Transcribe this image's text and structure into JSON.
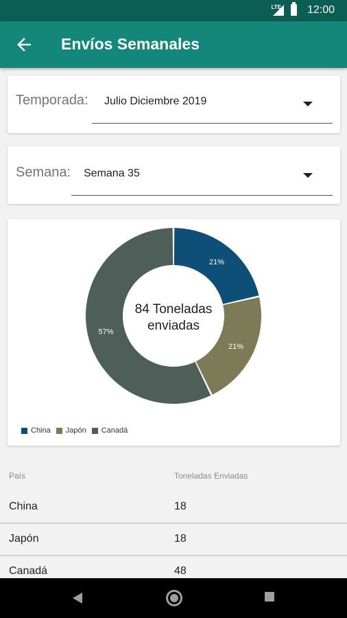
{
  "status_bar": {
    "network": "LTE",
    "time": "12:00"
  },
  "app_bar": {
    "title": "Envíos Semanales",
    "back_icon": "arrow-left-icon"
  },
  "season_selector": {
    "label": "Temporada:",
    "value": "Julio Diciembre 2019"
  },
  "week_selector": {
    "label": "Semana:",
    "value": "Semana 35"
  },
  "chart_data": {
    "type": "pie",
    "donut": true,
    "center_text": [
      "84 Toneladas",
      "enviadas"
    ],
    "categories": [
      "China",
      "Japón",
      "Canadá"
    ],
    "values": [
      18,
      18,
      48
    ],
    "percent_labels": [
      "21%",
      "21%",
      "57%"
    ],
    "colors": [
      "#0e4f78",
      "#7d7a57",
      "#4d5f58"
    ],
    "legend_position": "bottom-left"
  },
  "table": {
    "headers": [
      "País",
      "Toneladas Enviadas"
    ],
    "rows": [
      [
        "China",
        "18"
      ],
      [
        "Japón",
        "18"
      ],
      [
        "Canadá",
        "48"
      ]
    ]
  }
}
